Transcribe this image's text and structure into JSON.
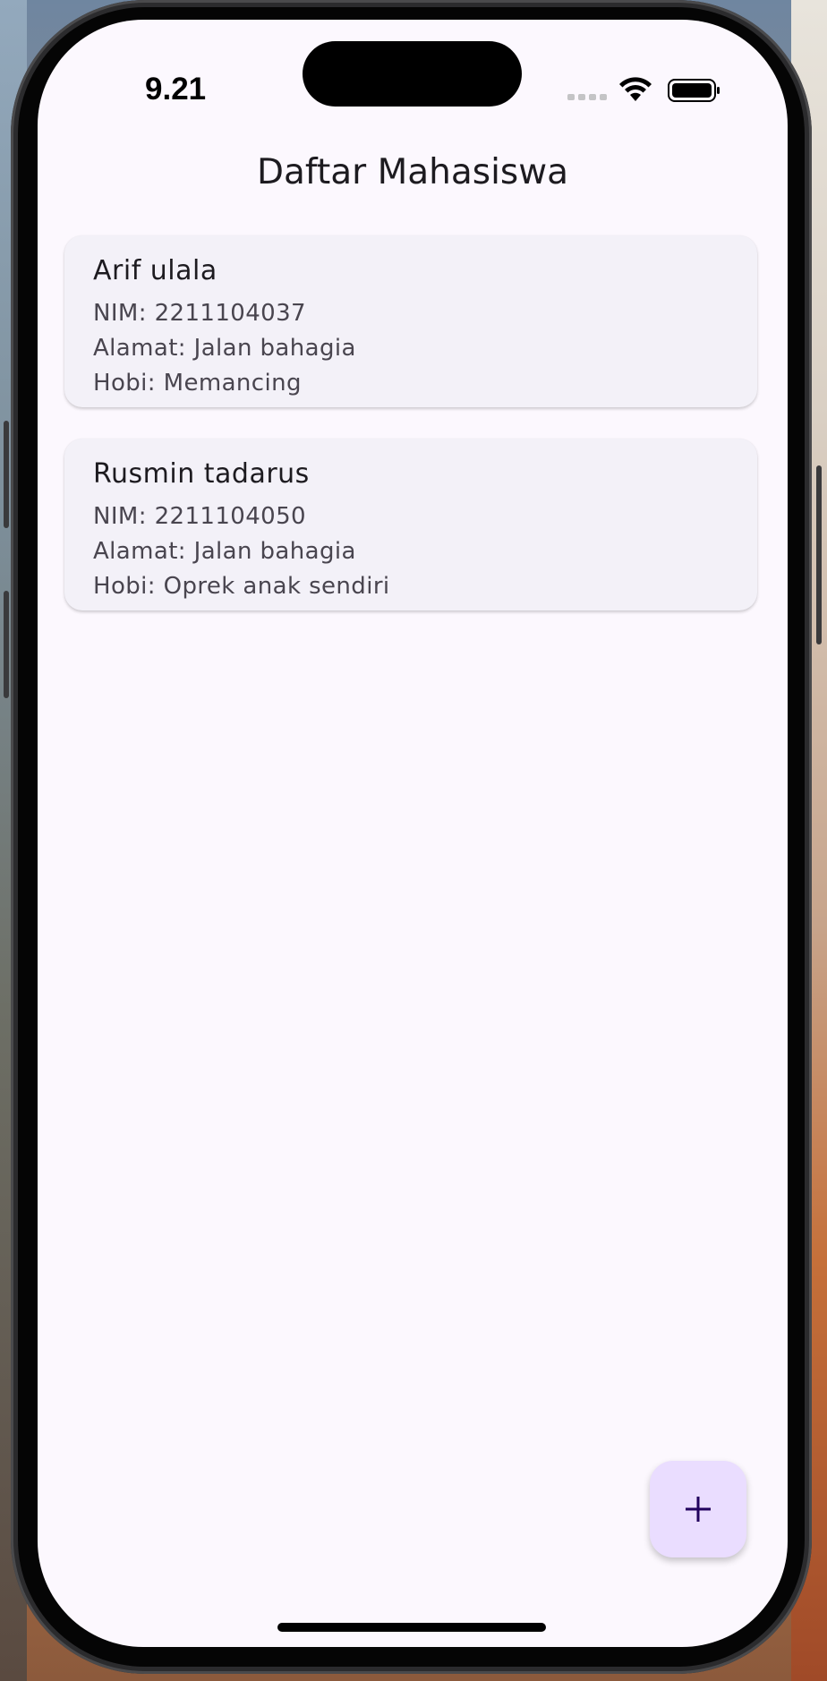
{
  "status_bar": {
    "time": "9.21"
  },
  "app_bar": {
    "title": "Daftar Mahasiswa"
  },
  "students": [
    {
      "name": "Arif ulala",
      "nim": "NIM: 2211104037",
      "alamat": "Alamat: Jalan bahagia",
      "hobi": "Hobi: Memancing"
    },
    {
      "name": "Rusmin tadarus",
      "nim": "NIM: 2211104050",
      "alamat": "Alamat: Jalan bahagia",
      "hobi": "Hobi: Oprek anak sendiri"
    }
  ],
  "fab": {
    "icon": "plus-icon"
  },
  "colors": {
    "background": "#fcf8fe",
    "card": "#f3f1f8",
    "fab": "#eaddff",
    "fab_icon": "#21005d"
  }
}
